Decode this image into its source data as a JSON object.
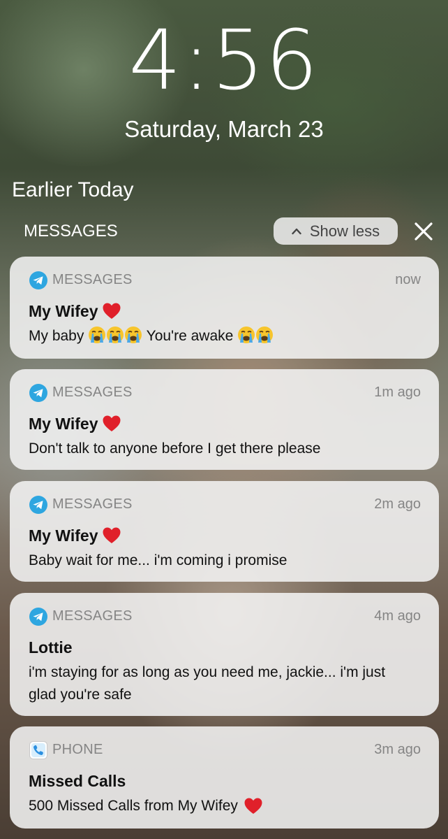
{
  "lockscreen": {
    "time": "4:56",
    "date": "Saturday, March 23"
  },
  "notifications_section": {
    "title": "Earlier Today",
    "group_label": "MESSAGES",
    "show_less_label": "Show less"
  },
  "notifications": [
    {
      "app": "MESSAGES",
      "app_icon": "telegram-icon",
      "time": "now",
      "title": "My Wifey",
      "body_parts": [
        "My baby ",
        " You're awake "
      ]
    },
    {
      "app": "MESSAGES",
      "app_icon": "telegram-icon",
      "time": "1m ago",
      "title": "My Wifey",
      "body": "Don't talk to anyone before I get there please"
    },
    {
      "app": "MESSAGES",
      "app_icon": "telegram-icon",
      "time": "2m ago",
      "title": "My Wifey",
      "body": "Baby wait for me... i'm coming i promise"
    },
    {
      "app": "MESSAGES",
      "app_icon": "telegram-icon",
      "time": "4m ago",
      "title": "Lottie",
      "body": "i'm staying for as long as you need me, jackie... i'm just glad you're safe"
    },
    {
      "app": "PHONE",
      "app_icon": "phone-icon",
      "time": "3m ago",
      "title": "Missed Calls",
      "body": "500 Missed Calls from My Wifey"
    }
  ],
  "colors": {
    "card_bg": "#f2f2f2",
    "secondary_text": "#858585",
    "telegram_blue": "#2ea6e0",
    "heart_red": "#e0202a"
  }
}
